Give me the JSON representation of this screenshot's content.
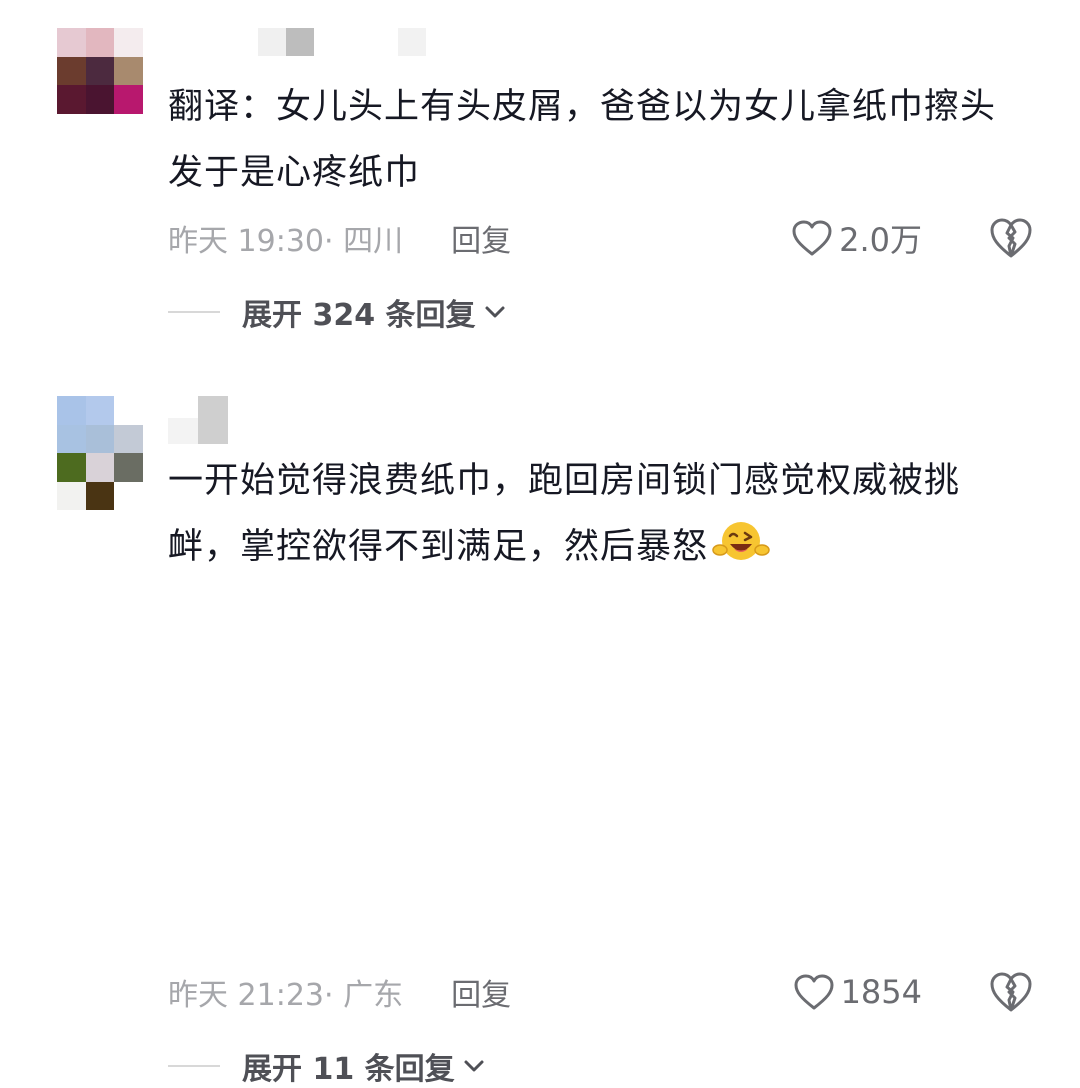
{
  "comments": [
    {
      "text": "翻译：女儿头上有头皮屑，爸爸以为女儿拿纸巾擦头发于是心疼纸巾",
      "time": "昨天 19:30",
      "location": "· 四川",
      "reply_label": "回复",
      "likes": "2.0万",
      "expand_label": "展开 324 条回复"
    },
    {
      "text": "一开始觉得浪费纸巾，跑回房间锁门感觉权威被挑衅，掌控欲得不到满足，然后暴怒",
      "time": "昨天 21:23",
      "location": "· 广东",
      "reply_label": "回复",
      "likes": "1854",
      "expand_label": "展开 11 条回复"
    }
  ],
  "icons": {
    "like": "heart-outline-icon",
    "dislike": "broken-heart-icon",
    "expand": "chevron-down-icon",
    "emoji": "laughing-wink-emoji-icon"
  },
  "colors": {
    "text": "#161823",
    "meta": "#a6a7ab",
    "action": "#6b6c71",
    "expand": "#4f5056"
  }
}
